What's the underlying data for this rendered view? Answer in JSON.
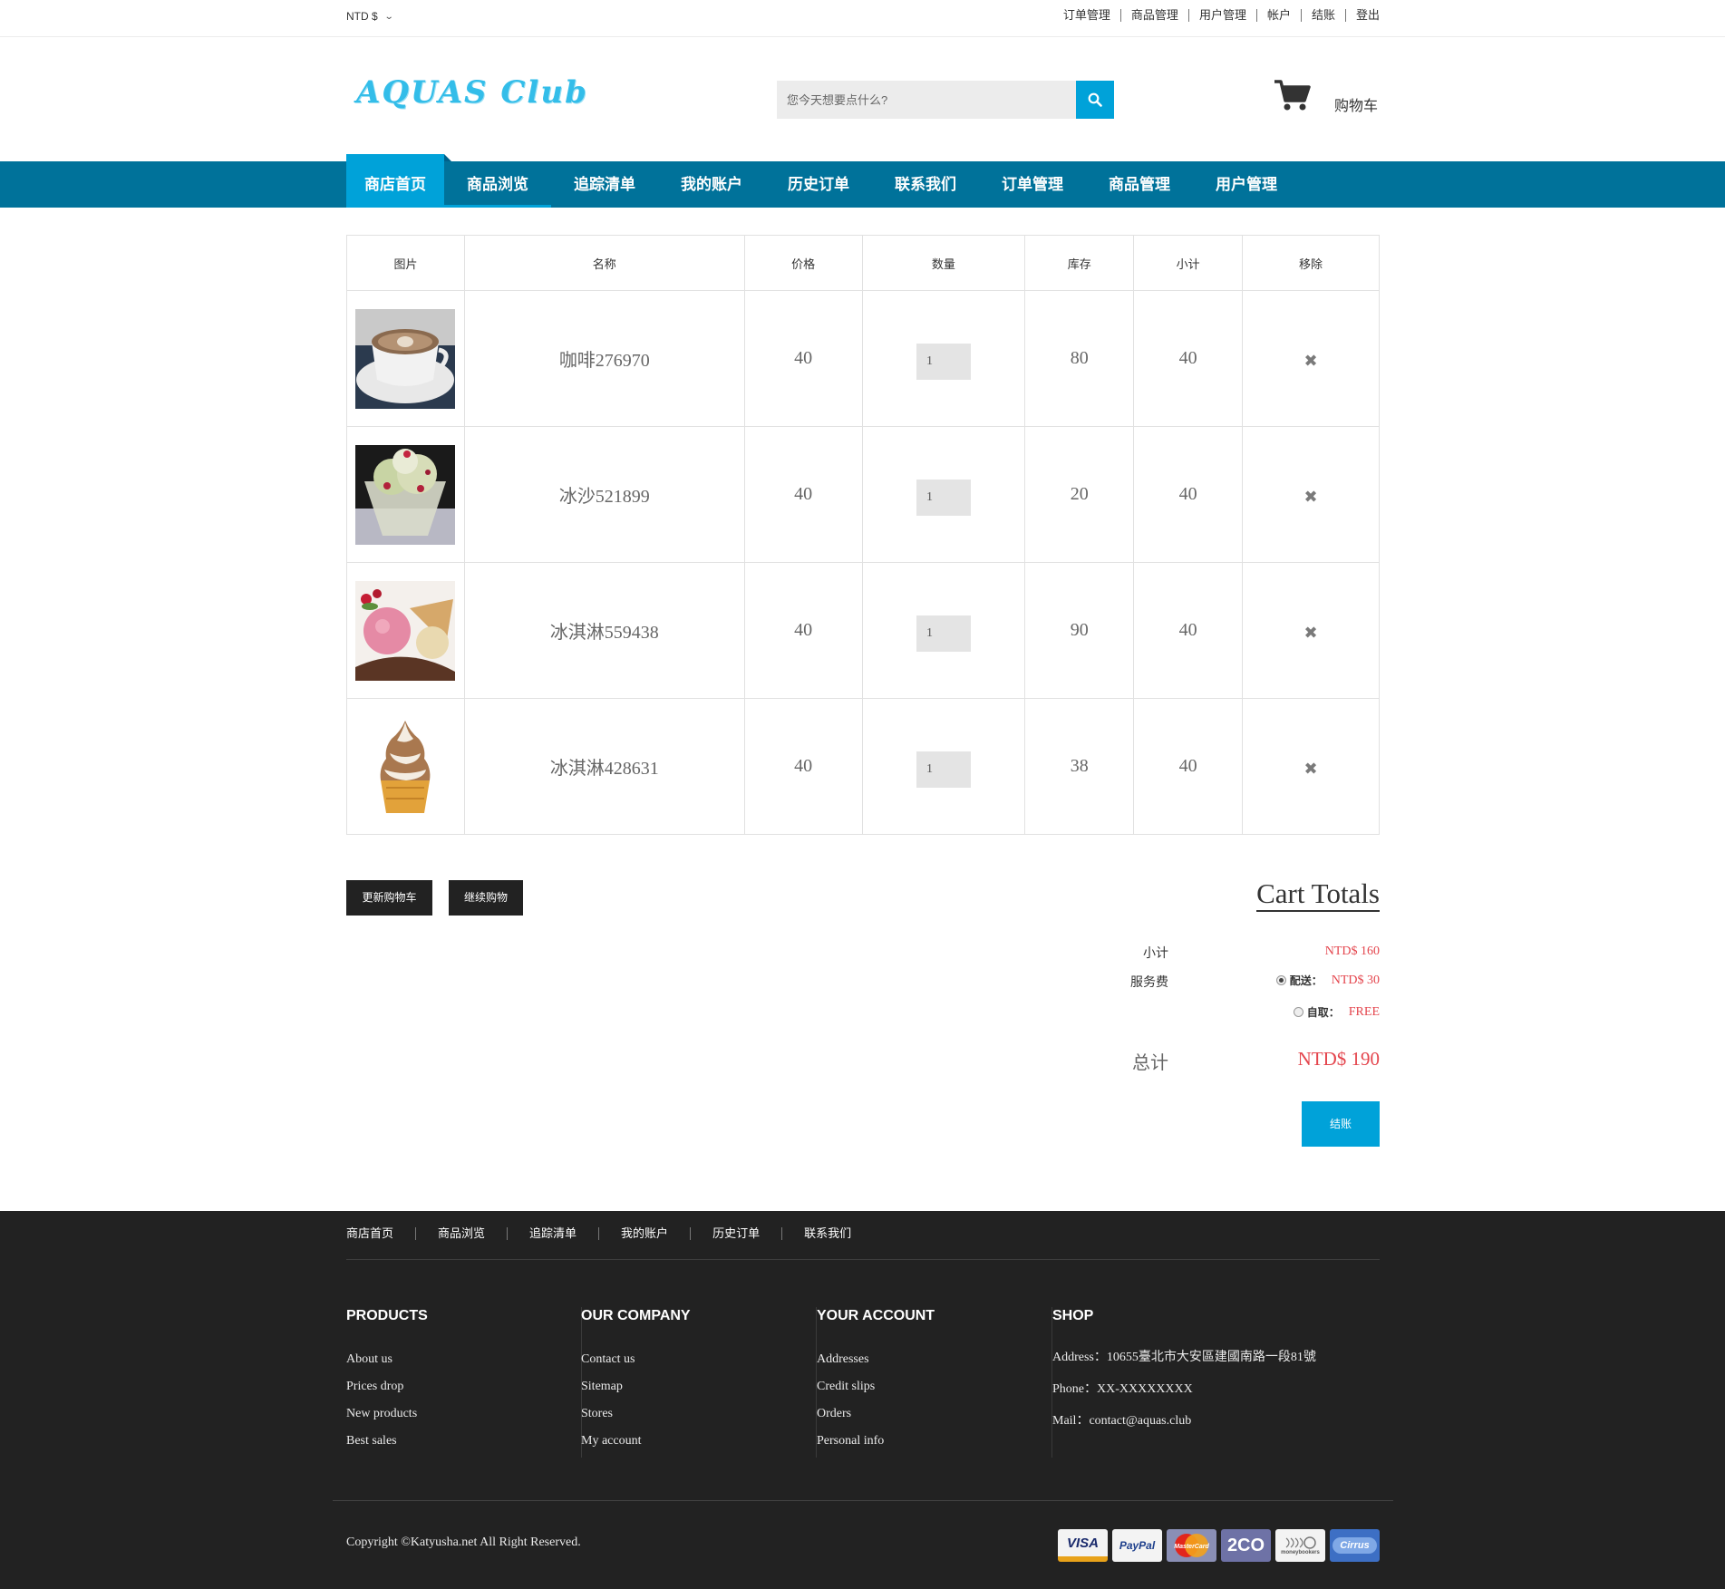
{
  "topbar": {
    "currency": "NTD $",
    "links": [
      "订单管理",
      "商品管理",
      "用户管理",
      "帐户",
      "结账",
      "登出"
    ]
  },
  "header": {
    "logo": "AQUAS Club",
    "search_placeholder": "您今天想要点什么?",
    "cart_label": "购物车"
  },
  "nav": [
    "商店首页",
    "商品浏览",
    "追踪清单",
    "我的账户",
    "历史订单",
    "联系我们",
    "订单管理",
    "商品管理",
    "用户管理"
  ],
  "table": {
    "headers": [
      "图片",
      "名称",
      "价格",
      "数量",
      "库存",
      "小计",
      "移除"
    ],
    "rows": [
      {
        "name": "咖啡276970",
        "price": "40",
        "qty": "1",
        "stock": "80",
        "subtotal": "40"
      },
      {
        "name": "冰沙521899",
        "price": "40",
        "qty": "1",
        "stock": "20",
        "subtotal": "40"
      },
      {
        "name": "冰淇淋559438",
        "price": "40",
        "qty": "1",
        "stock": "90",
        "subtotal": "40"
      },
      {
        "name": "冰淇淋428631",
        "price": "40",
        "qty": "1",
        "stock": "38",
        "subtotal": "40"
      }
    ],
    "remove_glyph": "✖"
  },
  "actions": {
    "update_cart": "更新购物车",
    "continue_shopping": "继续购物"
  },
  "totals": {
    "title": "Cart Totals",
    "subtotal_label": "小计",
    "subtotal_value": "NTD$ 160",
    "service_label": "服务费",
    "delivery_label": "配送：",
    "delivery_value": "NTD$ 30",
    "pickup_label": "自取：",
    "pickup_value": "FREE",
    "total_label": "总计",
    "total_value": "NTD$ 190",
    "checkout": "结账"
  },
  "footer": {
    "nav": [
      "商店首页",
      "商品浏览",
      "追踪清单",
      "我的账户",
      "历史订单",
      "联系我们"
    ],
    "columns": [
      {
        "title": "PRODUCTS",
        "items": [
          "About us",
          "Prices drop",
          "New products",
          "Best sales"
        ]
      },
      {
        "title": "OUR COMPANY",
        "items": [
          "Contact us",
          "Sitemap",
          "Stores",
          "My account"
        ]
      },
      {
        "title": "YOUR ACCOUNT",
        "items": [
          "Addresses",
          "Credit slips",
          "Orders",
          "Personal info"
        ]
      }
    ],
    "shop": {
      "title": "SHOP",
      "address": "Address：10655臺北市大安區建國南路一段81號",
      "phone": "Phone：XX-XXXXXXXX",
      "mail": "Mail：contact@aquas.club"
    },
    "copyright": "Copyright ©Katyusha.net All Right Reserved.",
    "payments": [
      "VISA",
      "PayPal",
      "MasterCard",
      "2CO",
      "moneybookers",
      "Cirrus"
    ]
  },
  "colors": {
    "accent": "#00a2d9",
    "nav_bg": "#00729a",
    "price_red": "#e4454d",
    "footer_bg": "#222222"
  }
}
